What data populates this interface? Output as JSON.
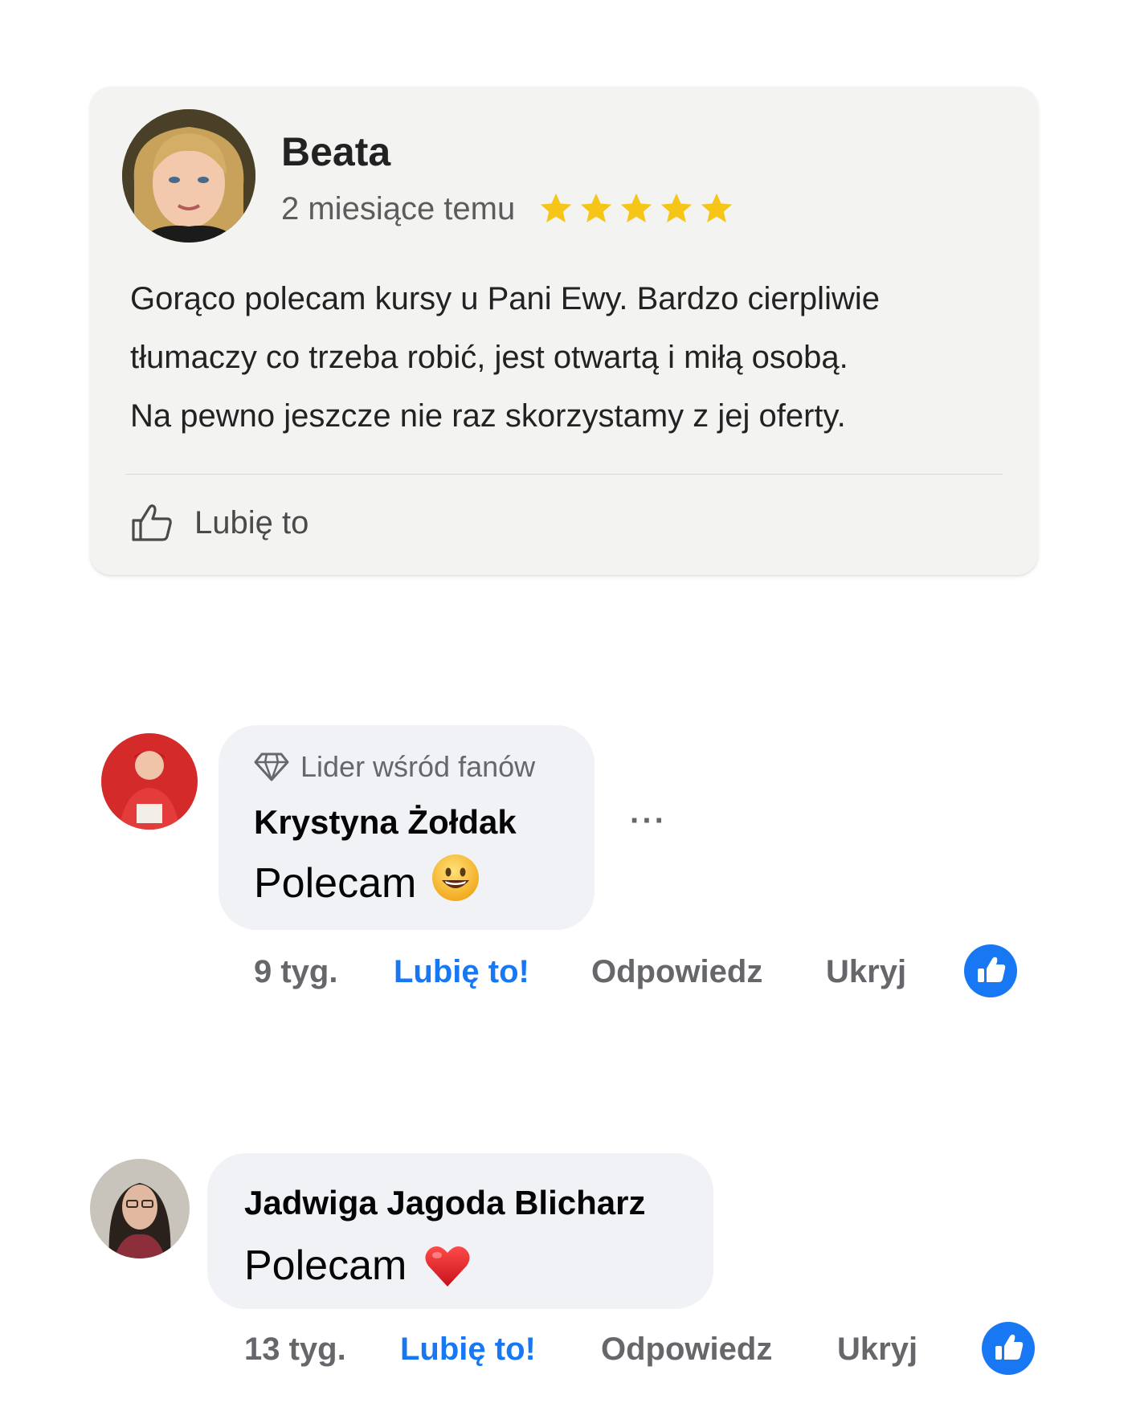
{
  "review": {
    "name": "Beata",
    "time": "2 miesiące temu",
    "rating": 5,
    "text_lines": [
      "Gorąco polecam kursy u Pani Ewy. Bardzo cierpliwie",
      "tłumaczy co trzeba robić, jest otwartą i miłą osobą.",
      "Na pewno jeszcze nie raz skorzystamy z jej oferty."
    ],
    "like_label": "Lubię to",
    "star_color": "#f5c518"
  },
  "comments": [
    {
      "badge": "Lider wśród fanów",
      "author": "Krystyna Żołdak",
      "text": "Polecam",
      "emoji": "smiley-emoji",
      "more": "···",
      "time": "9 tyg.",
      "like": "Lubię to!",
      "reply": "Odpowiedz",
      "hide": "Ukryj",
      "reaction": "like-reaction-icon"
    },
    {
      "author": "Jadwiga Jagoda Blicharz",
      "text": "Polecam",
      "emoji": "heart-emoji",
      "time": "13 tyg.",
      "like": "Lubię to!",
      "reply": "Odpowiedz",
      "hide": "Ukryj",
      "reaction": "like-reaction-icon"
    }
  ],
  "colors": {
    "facebook_blue": "#1877f2",
    "bubble_bg": "#f0f2f5",
    "secondary_text": "#65676b"
  }
}
